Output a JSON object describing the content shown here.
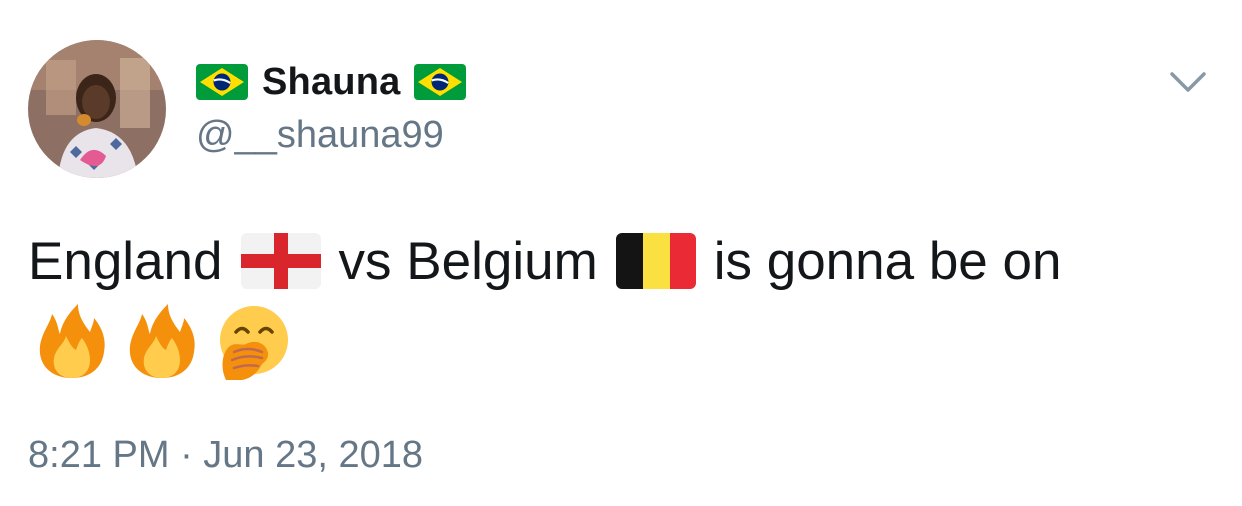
{
  "user": {
    "display_name": "Shauna",
    "handle": "@__shauna99",
    "name_emoji_left": "brazil-flag-icon",
    "name_emoji_right": "brazil-flag-icon"
  },
  "tweet": {
    "text_segments": [
      "England",
      "vs Belgium",
      "is gonna be on"
    ],
    "inline_emoji": [
      "england-flag-icon",
      "belgium-flag-icon"
    ],
    "trailing_emoji": [
      "fire-icon",
      "fire-icon",
      "hand-over-mouth-face-icon"
    ],
    "timestamp": "8:21 PM · Jun 23, 2018"
  },
  "menu": {
    "icon": "chevron-down-icon"
  },
  "colors": {
    "text_primary": "#14171a",
    "text_secondary": "#657786",
    "background": "#ffffff"
  }
}
